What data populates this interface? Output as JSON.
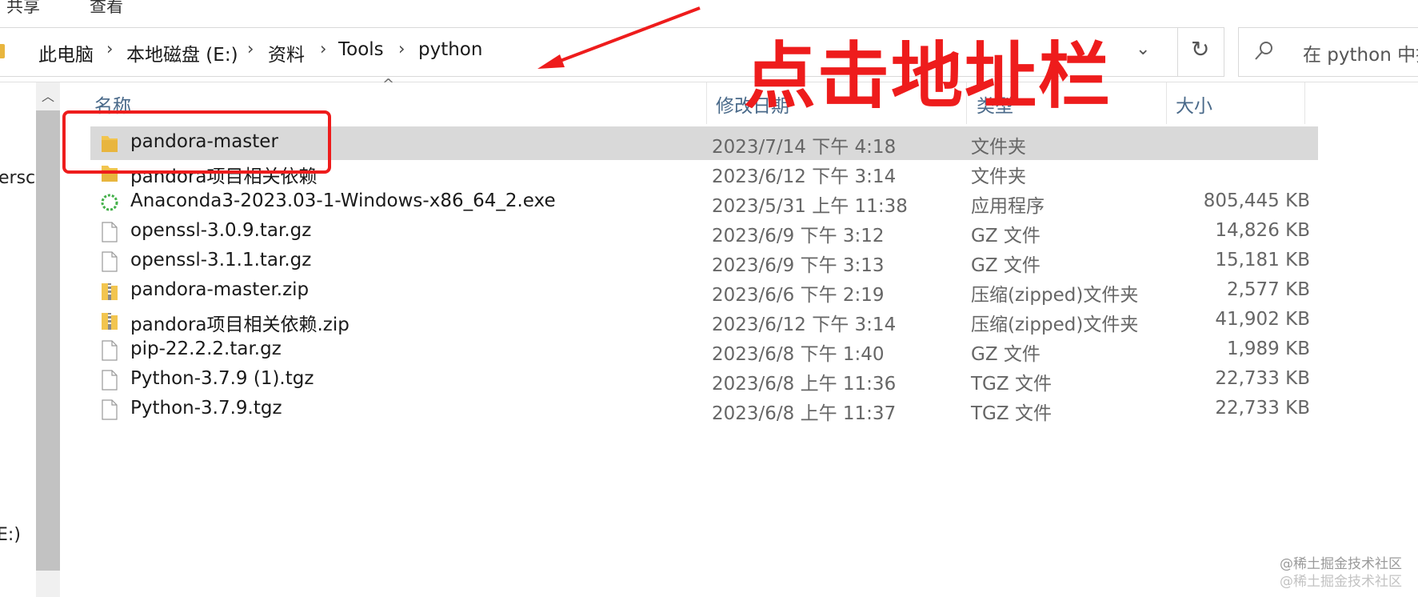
{
  "ribbon": {
    "tabs": [
      "共享",
      "查看"
    ]
  },
  "address_bar": {
    "crumbs": [
      "此电脑",
      "本地磁盘 (E:)",
      "资料",
      "Tools",
      "python"
    ],
    "dropdown_glyph": "⌄",
    "refresh_glyph": "↻"
  },
  "search": {
    "placeholder": "在 python 中搜索"
  },
  "nav_pane": {
    "fragments": [
      "ersc",
      "E:)"
    ]
  },
  "columns": {
    "name": "名称",
    "modified": "修改日期",
    "type": "类型",
    "size": "大小"
  },
  "files": [
    {
      "name": "pandora-master",
      "date": "2023/7/14 下午 4:18",
      "type": "文件夹",
      "size": "",
      "icon": "folder-icon",
      "selected": true
    },
    {
      "name": "pandora项目相关依赖",
      "date": "2023/6/12 下午 3:14",
      "type": "文件夹",
      "size": "",
      "icon": "folder-icon"
    },
    {
      "name": "Anaconda3-2023.03-1-Windows-x86_64_2.exe",
      "date": "2023/5/31 上午 11:38",
      "type": "应用程序",
      "size": "805,445 KB",
      "icon": "anaconda-app-icon"
    },
    {
      "name": "openssl-3.0.9.tar.gz",
      "date": "2023/6/9 下午 3:12",
      "type": "GZ 文件",
      "size": "14,826 KB",
      "icon": "file-icon"
    },
    {
      "name": "openssl-3.1.1.tar.gz",
      "date": "2023/6/9 下午 3:13",
      "type": "GZ 文件",
      "size": "15,181 KB",
      "icon": "file-icon"
    },
    {
      "name": "pandora-master.zip",
      "date": "2023/6/6 下午 2:19",
      "type": "压缩(zipped)文件夹",
      "size": "2,577 KB",
      "icon": "zip-folder-icon"
    },
    {
      "name": "pandora项目相关依赖.zip",
      "date": "2023/6/12 下午 3:14",
      "type": "压缩(zipped)文件夹",
      "size": "41,902 KB",
      "icon": "zip-folder-icon"
    },
    {
      "name": "pip-22.2.2.tar.gz",
      "date": "2023/6/8 下午 1:40",
      "type": "GZ 文件",
      "size": "1,989 KB",
      "icon": "file-icon"
    },
    {
      "name": "Python-3.7.9 (1).tgz",
      "date": "2023/6/8 上午 11:36",
      "type": "TGZ 文件",
      "size": "22,733 KB",
      "icon": "file-icon"
    },
    {
      "name": "Python-3.7.9.tgz",
      "date": "2023/6/8 上午 11:37",
      "type": "TGZ 文件",
      "size": "22,733 KB",
      "icon": "file-icon"
    }
  ],
  "annotation": {
    "text": "点击地址栏",
    "color": "#ee1c1c"
  },
  "watermark": {
    "line1": "@稀土掘金技术社区",
    "line2": "@稀土掘金技术社区"
  },
  "colors": {
    "selected_row": "#d9d9d9",
    "header_text": "#4a6a8a",
    "folder": "#e8b53e"
  }
}
